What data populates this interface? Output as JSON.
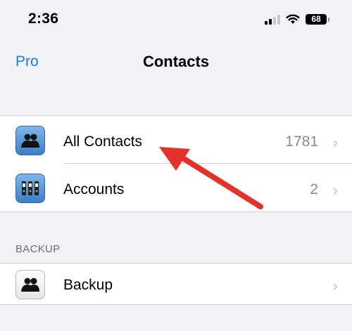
{
  "status_bar": {
    "time": "2:36",
    "battery": "68"
  },
  "nav": {
    "back_label": "Pro",
    "title": "Contacts"
  },
  "main_group": {
    "items": [
      {
        "label": "All Contacts",
        "value": "1781",
        "icon": "contacts-icon"
      },
      {
        "label": "Accounts",
        "value": "2",
        "icon": "binders-icon"
      }
    ]
  },
  "backup_section": {
    "header": "BACKUP",
    "items": [
      {
        "label": "Backup",
        "icon": "contacts-icon"
      }
    ]
  },
  "chevron": "›",
  "colors": {
    "accent": "#1a7cf5",
    "arrow": "#e5312b",
    "background": "#f2f2f7"
  }
}
